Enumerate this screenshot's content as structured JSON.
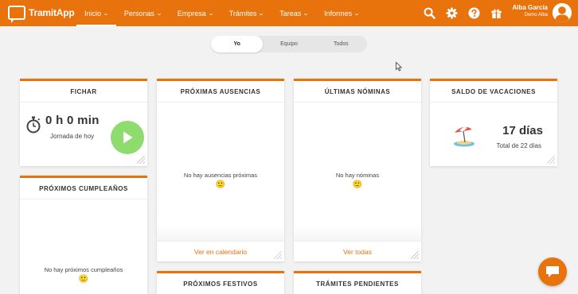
{
  "brand": {
    "name": "TramitApp",
    "color": "#e8720c"
  },
  "nav": [
    {
      "label": "Inicio",
      "active": true
    },
    {
      "label": "Personas"
    },
    {
      "label": "Empresa"
    },
    {
      "label": "Trámites"
    },
    {
      "label": "Tareas"
    },
    {
      "label": "Informes"
    }
  ],
  "top_icons": [
    "search-icon",
    "gear-icon",
    "help-icon",
    "gift-icon"
  ],
  "user": {
    "name": "Alba García",
    "company": "Demo Alba"
  },
  "scope_tabs": [
    {
      "label": "Yo",
      "active": true
    },
    {
      "label": "Equipo"
    },
    {
      "label": "Todos"
    }
  ],
  "cards": {
    "fichar": {
      "title": "FICHAR",
      "time": "0 h 0 min",
      "subtitle": "Jornada de hoy"
    },
    "ausencias": {
      "title": "PRÓXIMAS AUSENCIAS",
      "empty": "No hay ausencias próximas",
      "emoji": "🙂",
      "link": "Ver en calendario"
    },
    "nominas": {
      "title": "ÚLTIMAS NÓMINAS",
      "empty": "No hay nóminas",
      "emoji": "🙂",
      "link": "Ver todas"
    },
    "vacaciones": {
      "title": "SALDO DE VACACIONES",
      "days": "17 días",
      "total": "Total de 22 días"
    },
    "cumpleanos": {
      "title": "PRÓXIMOS CUMPLEAÑOS",
      "empty": "No hay próximos cumpleaños",
      "emoji": "🙂"
    },
    "festivos": {
      "title": "PRÓXIMOS FESTIVOS"
    },
    "tramites": {
      "title": "TRÁMITES PENDIENTES"
    }
  }
}
